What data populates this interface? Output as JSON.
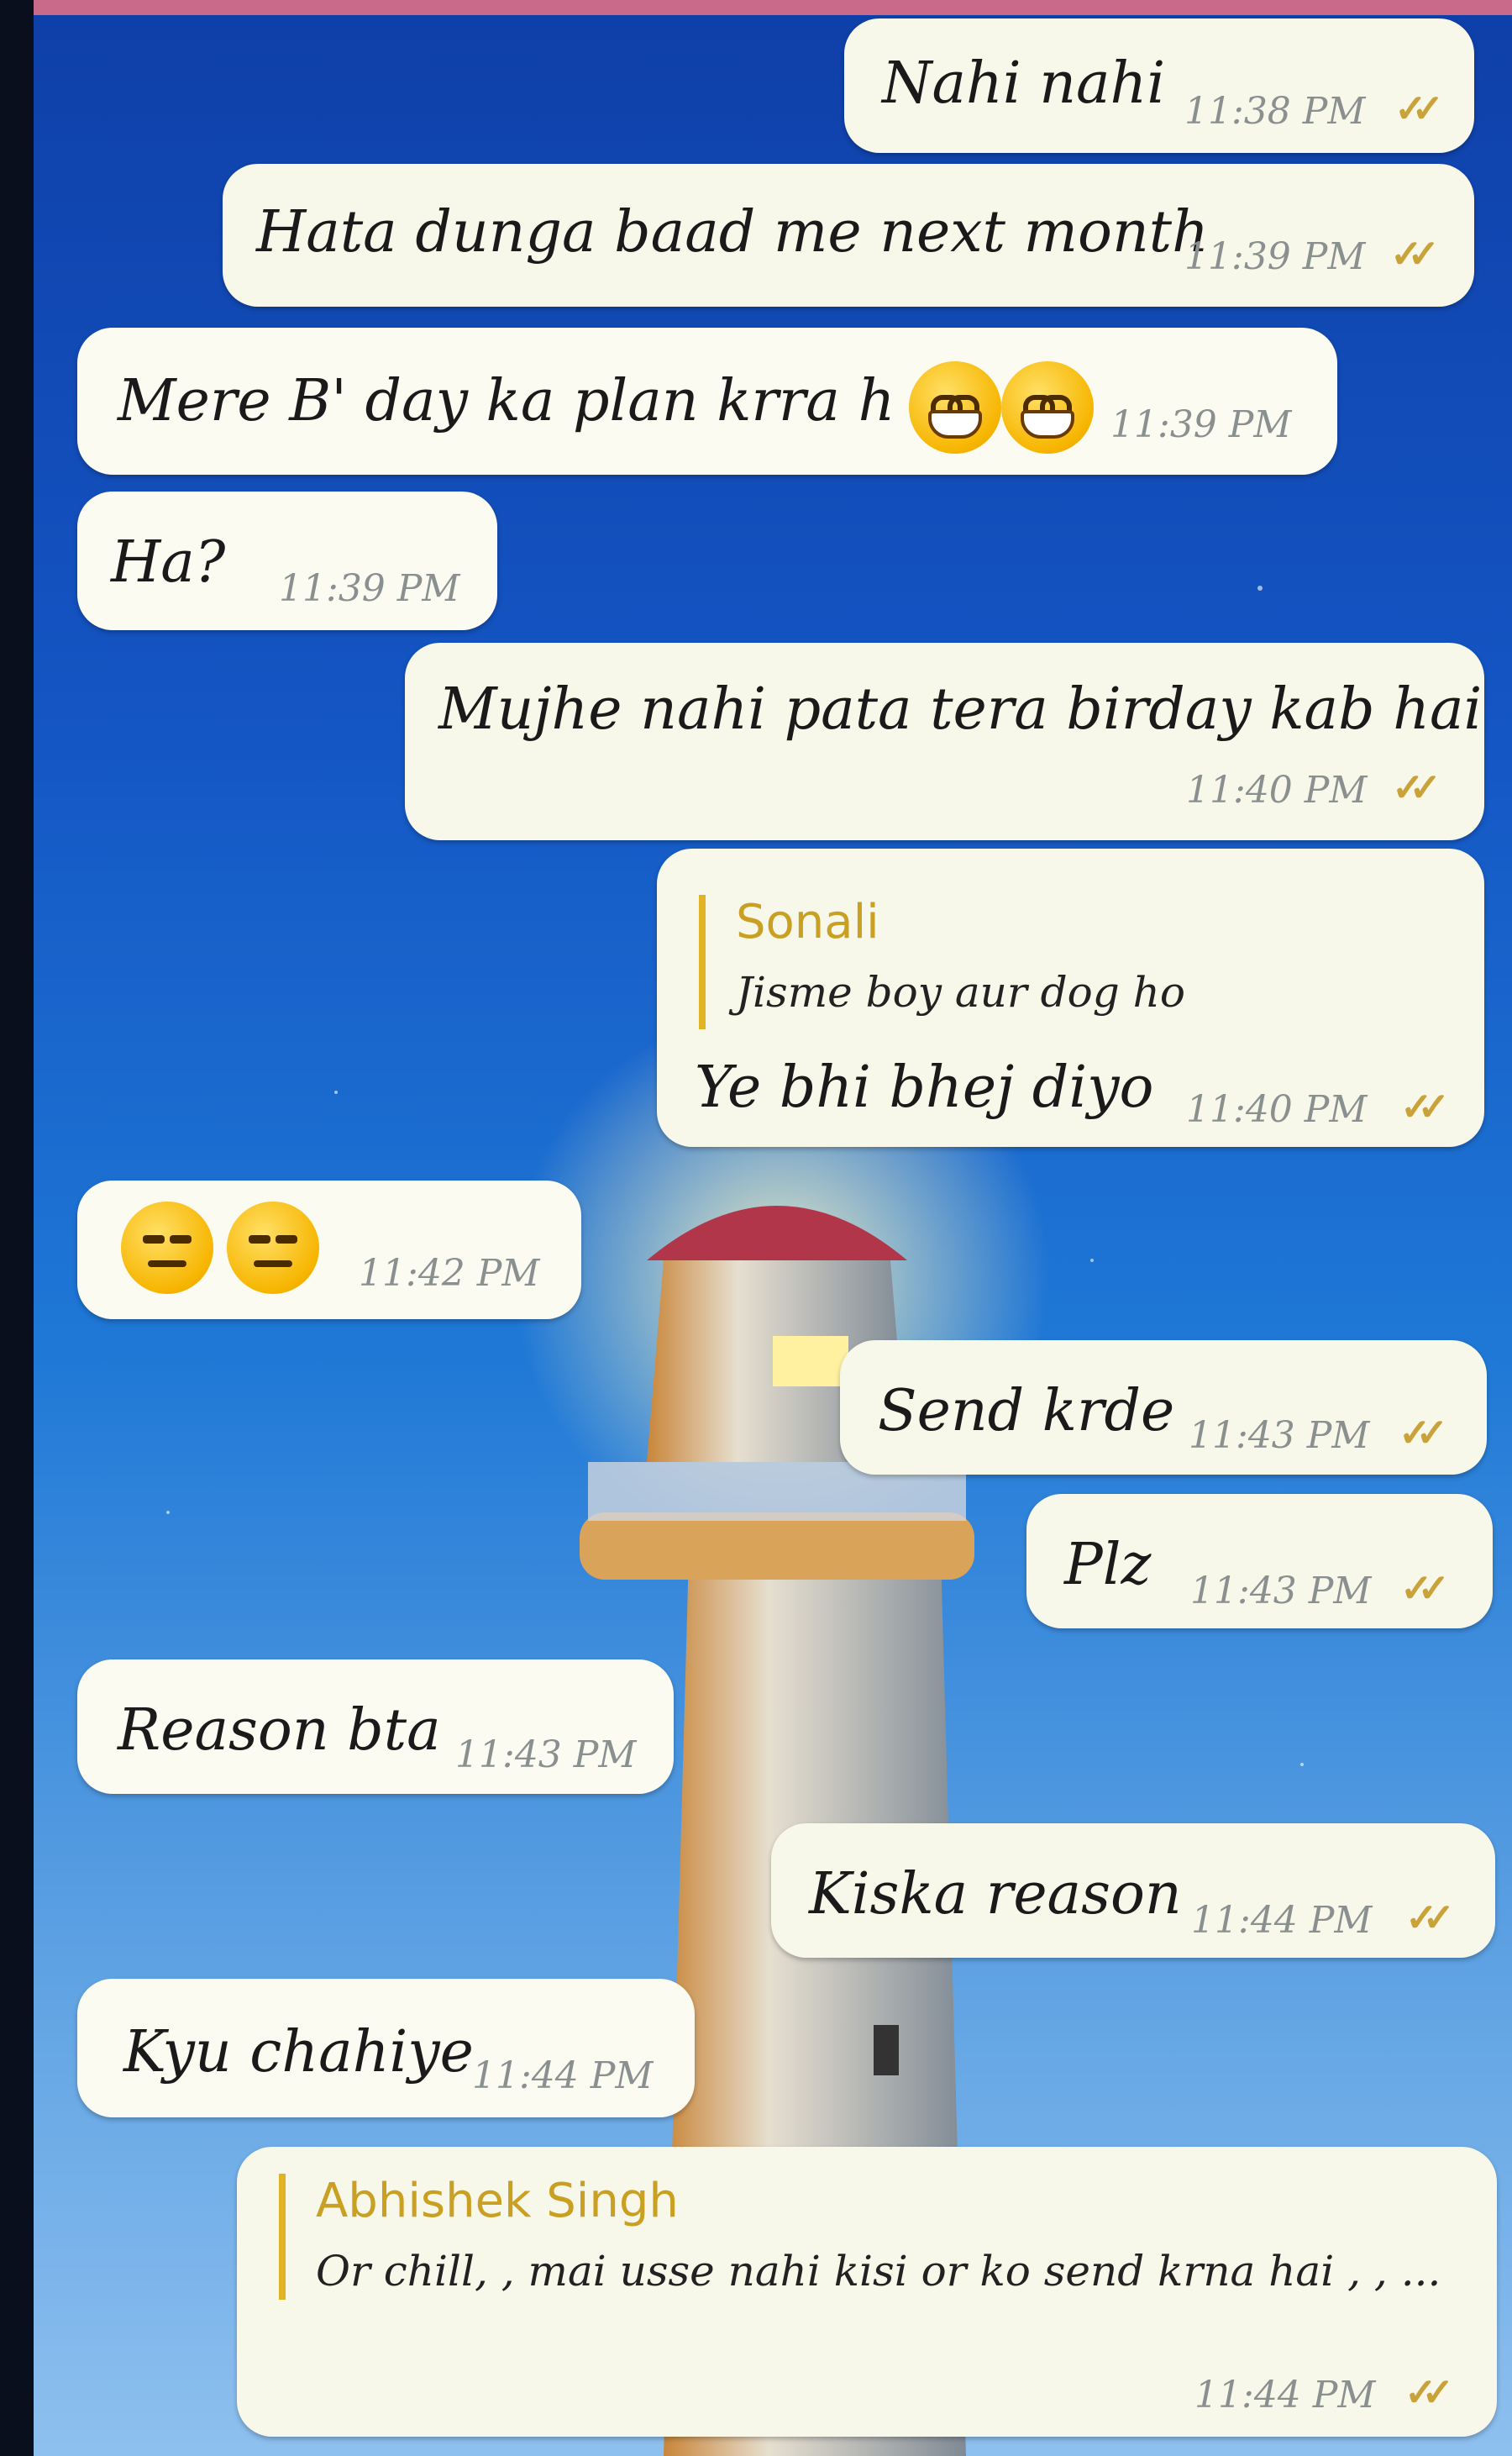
{
  "chat": {
    "messages": [
      {
        "dir": "out",
        "text": "Nahi nahi",
        "time": "11:38 PM"
      },
      {
        "dir": "out",
        "text": "Hata dunga baad me next month",
        "time": "11:39 PM"
      },
      {
        "dir": "in",
        "text": "Mere B' day ka plan krra h",
        "emoji": "grinning-face",
        "emoji_count": 2,
        "time": "11:39 PM"
      },
      {
        "dir": "in",
        "text": "Ha?",
        "time": "11:39 PM"
      },
      {
        "dir": "out",
        "text": "Mujhe nahi pata tera birday kab hai",
        "time": "11:40 PM"
      },
      {
        "dir": "out",
        "reply_to": {
          "name": "Sonali",
          "text": "Jisme boy aur dog ho"
        },
        "text": "Ye bhi bhej diyo",
        "time": "11:40 PM"
      },
      {
        "dir": "in",
        "emoji": "expressionless-face",
        "emoji_count": 2,
        "time": "11:42 PM"
      },
      {
        "dir": "out",
        "text": "Send krde",
        "time": "11:43 PM"
      },
      {
        "dir": "out",
        "text": "Plz",
        "time": "11:43 PM"
      },
      {
        "dir": "in",
        "text": "Reason bta",
        "time": "11:43 PM"
      },
      {
        "dir": "out",
        "text": "Kiska reason",
        "time": "11:44 PM"
      },
      {
        "dir": "in",
        "text": "Kyu chahiye",
        "time": "11:44 PM"
      },
      {
        "dir": "out",
        "reply_to": {
          "name": "Abhishek Singh",
          "text": "Or chill, , mai usse nahi kisi or ko send krna hai , , ..."
        },
        "text": "",
        "time": "11:44 PM"
      }
    ]
  },
  "colors": {
    "quote_bar": "#e0b423",
    "quote_name": "#caa023",
    "read_tick": "#c9a23a",
    "bubble": "#fbfbf2"
  },
  "icons": {
    "read_receipt": "double-check-icon"
  }
}
